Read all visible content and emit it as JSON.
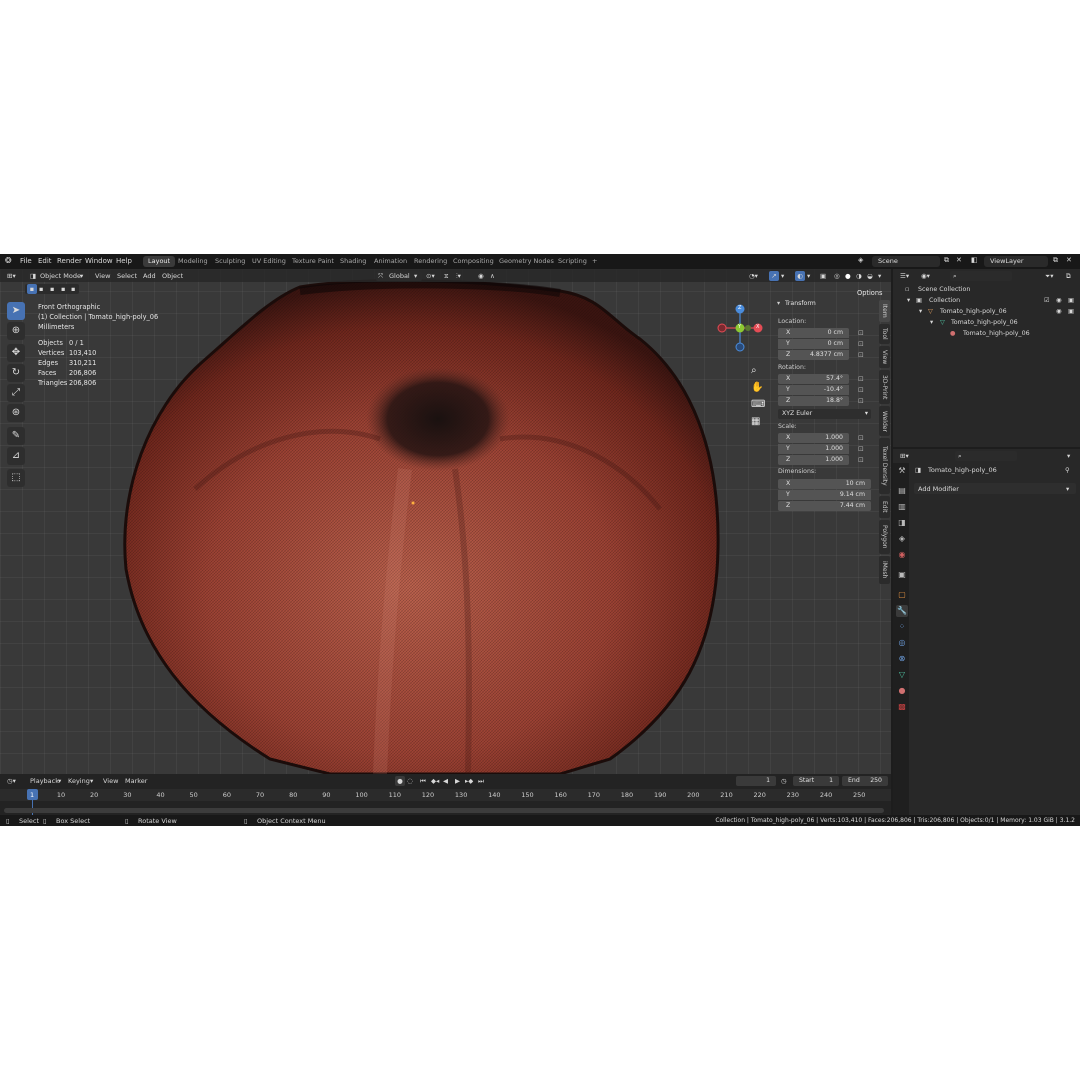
{
  "topbar": {
    "menus": [
      "File",
      "Edit",
      "Render",
      "Window",
      "Help"
    ],
    "workspaces": [
      "Layout",
      "Modeling",
      "Sculpting",
      "UV Editing",
      "Texture Paint",
      "Shading",
      "Animation",
      "Rendering",
      "Compositing",
      "Geometry Nodes",
      "Scripting"
    ],
    "add_tab": "+",
    "scene": "Scene",
    "view_layer": "ViewLayer"
  },
  "viewport_header": {
    "mode": "Object Mode",
    "menus": [
      "View",
      "Select",
      "Add",
      "Object"
    ],
    "orientation": "Global",
    "options": "Options"
  },
  "overlay": {
    "view_name": "Front Orthographic",
    "collection": "(1) Collection | Tomato_high-poly_06",
    "units": "Millimeters",
    "stats": [
      {
        "label": "Objects",
        "value": "0 / 1"
      },
      {
        "label": "Vertices",
        "value": "103,410"
      },
      {
        "label": "Edges",
        "value": "310,211"
      },
      {
        "label": "Faces",
        "value": "206,806"
      },
      {
        "label": "Triangles",
        "value": "206,806"
      }
    ]
  },
  "gizmo": {
    "x": "X",
    "y": "Y",
    "z": "Z"
  },
  "transform": {
    "title": "Transform",
    "location_label": "Location:",
    "location": [
      {
        "axis": "X",
        "value": "0 cm"
      },
      {
        "axis": "Y",
        "value": "0 cm"
      },
      {
        "axis": "Z",
        "value": "4.8377 cm"
      }
    ],
    "rotation_label": "Rotation:",
    "rotation": [
      {
        "axis": "X",
        "value": "57.4°"
      },
      {
        "axis": "Y",
        "value": "-10.4°"
      },
      {
        "axis": "Z",
        "value": "18.8°"
      }
    ],
    "rotation_mode": "XYZ Euler",
    "scale_label": "Scale:",
    "scale": [
      {
        "axis": "X",
        "value": "1.000"
      },
      {
        "axis": "Y",
        "value": "1.000"
      },
      {
        "axis": "Z",
        "value": "1.000"
      }
    ],
    "dimensions_label": "Dimensions:",
    "dimensions": [
      {
        "axis": "X",
        "value": "10 cm"
      },
      {
        "axis": "Y",
        "value": "9.14 cm"
      },
      {
        "axis": "Z",
        "value": "7.44 cm"
      }
    ]
  },
  "side_tabs": [
    "Item",
    "Tool",
    "View",
    "3D-Print",
    "Welder",
    "Texel Density",
    "Edit",
    "Polygon",
    "iMesh"
  ],
  "timeline": {
    "menus": [
      "Playback",
      "Keying",
      "View",
      "Marker"
    ],
    "current_frame": "1",
    "start_label": "Start",
    "start": "1",
    "end_label": "End",
    "end": "250",
    "ruler": [
      "1",
      "10",
      "20",
      "30",
      "40",
      "50",
      "60",
      "70",
      "80",
      "90",
      "100",
      "110",
      "120",
      "130",
      "140",
      "150",
      "160",
      "170",
      "180",
      "190",
      "200",
      "210",
      "220",
      "230",
      "240",
      "250"
    ]
  },
  "statusbar": {
    "select": "Select",
    "box_select": "Box Select",
    "rotate_view": "Rotate View",
    "context_menu": "Object Context Menu",
    "info": "Collection | Tomato_high-poly_06 | Verts:103,410 | Faces:206,806 | Tris:206,806 | Objects:0/1 | Memory: 1.03 GiB | 3.1.2"
  },
  "outliner": {
    "scene_collection": "Scene Collection",
    "collection": "Collection",
    "object": "Tomato_high-poly_06",
    "mesh": "Tomato_high-poly_06",
    "material": "Tomato_high-poly_06"
  },
  "properties": {
    "object_name": "Tomato_high-poly_06",
    "add_modifier": "Add Modifier"
  },
  "colors": {
    "accent": "#4772b3",
    "tomato_center": "#b65c48",
    "tomato_edge": "#6a241a",
    "x_axis": "#e44c55",
    "y_axis": "#8cc832",
    "z_axis": "#4a8cdc"
  }
}
